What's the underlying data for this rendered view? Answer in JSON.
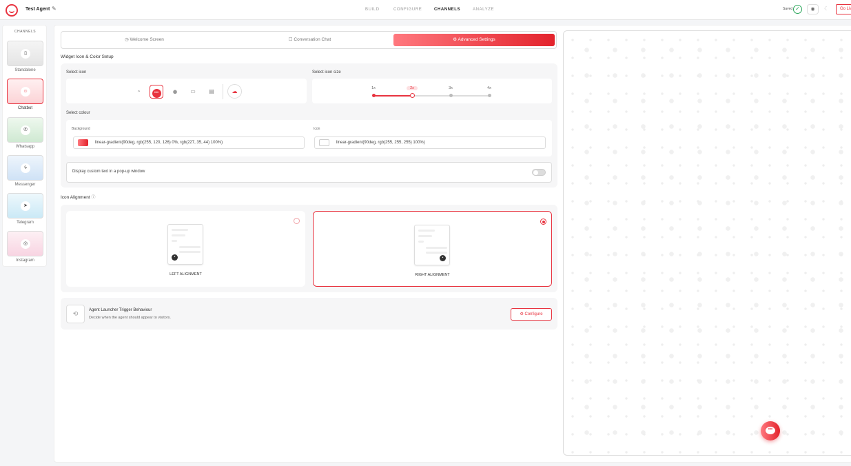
{
  "header": {
    "agent_name": "Test Agent",
    "nav": [
      "BUILD",
      "CONFIGURE",
      "CHANNELS",
      "ANALYZE"
    ],
    "active_nav": "CHANNELS",
    "saved_label": "Saved",
    "go_live_label": "Go Live"
  },
  "channels": {
    "title": "CHANNELS",
    "items": [
      {
        "label": "Standalone",
        "icon": "phone-icon"
      },
      {
        "label": "Chatbot",
        "icon": "chatbot-icon",
        "active": true
      },
      {
        "label": "Whatsapp",
        "icon": "whatsapp-icon"
      },
      {
        "label": "Messenger",
        "icon": "messenger-icon"
      },
      {
        "label": "Telegram",
        "icon": "telegram-icon"
      },
      {
        "label": "Instagram",
        "icon": "instagram-icon"
      }
    ]
  },
  "tabs": [
    {
      "label": "Welcome Screen",
      "icon": "clock-icon"
    },
    {
      "label": "Conversation Chat",
      "icon": "chat-icon"
    },
    {
      "label": "Advanced Settings",
      "icon": "gear-icon",
      "active": true
    }
  ],
  "widget_setup": {
    "title": "Widget Icon & Color Setup",
    "select_icon_label": "Select icon",
    "select_icon_size_label": "Select icon size",
    "sizes": [
      "1x",
      "2x",
      "3x",
      "4x"
    ],
    "selected_size": "2x",
    "select_colour_label": "Select colour",
    "background_label": "Background",
    "background_value": "linear-gradient(90deg, rgb(255, 120, 126) 0%, rgb(227, 35, 44) 100%)",
    "icon_label": "Icon",
    "icon_value": "linear-gradient(90deg, rgb(255, 255, 255) 100%)",
    "popup_text_label": "Display custom text in a pop-up window",
    "popup_enabled": false
  },
  "icon_alignment": {
    "title": "Icon Alignment",
    "left_label": "LEFT ALIGNMENT",
    "right_label": "RIGHT ALIGNMENT",
    "selected": "right"
  },
  "trigger": {
    "title": "Agent Launcher Trigger Behaviour",
    "description": "Decide when the agent should appear to visitors.",
    "button_label": "Configure"
  },
  "colors": {
    "accent": "#e8333f",
    "gradient_start": "#ff787e",
    "gradient_end": "#e3232c"
  }
}
